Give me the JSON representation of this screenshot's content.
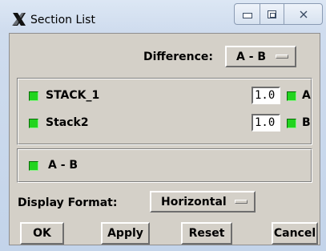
{
  "window": {
    "title": "Section List",
    "app_icon": "x-app-icon"
  },
  "difference": {
    "label": "Difference:",
    "selected": "A - B"
  },
  "stacks": [
    {
      "name": "STACK_1",
      "value": "1.0",
      "slot": "A",
      "enabled": true
    },
    {
      "name": "Stack2",
      "value": "1.0",
      "slot": "B",
      "enabled": true
    }
  ],
  "difference_entry": {
    "label": "A - B",
    "enabled": true
  },
  "display_format": {
    "label": "Display Format:",
    "selected": "Horizontal"
  },
  "buttons": {
    "ok": "OK",
    "apply": "Apply",
    "reset": "Reset",
    "cancel": "Cancel"
  },
  "colors": {
    "toggle_on": "#22d41f",
    "panel": "#d4d0c8"
  }
}
